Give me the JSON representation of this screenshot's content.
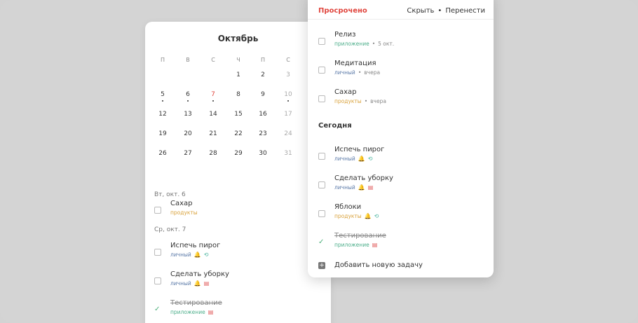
{
  "calendar": {
    "month_title": "Октябрь",
    "weekdays": [
      "П",
      "В",
      "С",
      "Ч",
      "П",
      "С"
    ],
    "weeks": [
      [
        "",
        "",
        "",
        "1",
        "2",
        "3"
      ],
      [
        "5",
        "6",
        "7",
        "8",
        "9",
        "10"
      ],
      [
        "12",
        "13",
        "14",
        "15",
        "16",
        "17"
      ],
      [
        "19",
        "20",
        "21",
        "22",
        "23",
        "24"
      ],
      [
        "26",
        "27",
        "28",
        "29",
        "30",
        "31"
      ]
    ],
    "today": "7",
    "days_with_tasks": [
      "5",
      "6",
      "7",
      "10"
    ],
    "groups": [
      {
        "date_label": "Вт, окт. 6",
        "tasks": [
          {
            "title": "Сахар",
            "tag": "продукты",
            "tag_type": "products",
            "done": false,
            "icons": []
          }
        ]
      },
      {
        "date_label": "Ср, окт. 7",
        "tasks": [
          {
            "title": "Испечь пирог",
            "tag": "личный",
            "tag_type": "personal",
            "done": false,
            "icons": [
              "bell-icon",
              "repeat-icon"
            ]
          },
          {
            "title": "Сделать уборку",
            "tag": "личный",
            "tag_type": "personal",
            "done": false,
            "icons": [
              "bell-icon",
              "document-icon"
            ]
          },
          {
            "title": "Тестирование",
            "tag": "приложение",
            "tag_type": "app",
            "done": true,
            "icons": [
              "document-icon"
            ]
          }
        ]
      }
    ]
  },
  "task_list": {
    "overdue_label": "Просрочено",
    "actions": {
      "hide": "Скрыть",
      "separator": "•",
      "reschedule": "Перенести"
    },
    "overdue": [
      {
        "title": "Релиз",
        "tag": "приложение",
        "tag_type": "app",
        "date": "5 окт."
      },
      {
        "title": "Медитация",
        "tag": "личный",
        "tag_type": "personal",
        "date": "вчера"
      },
      {
        "title": "Сахар",
        "tag": "продукты",
        "tag_type": "products",
        "date": "вчера"
      }
    ],
    "today_label": "Сегодня",
    "today": [
      {
        "title": "Испечь пирог",
        "tag": "личный",
        "tag_type": "personal",
        "done": false,
        "icons": [
          "bell-icon",
          "repeat-icon"
        ]
      },
      {
        "title": "Сделать уборку",
        "tag": "личный",
        "tag_type": "personal",
        "done": false,
        "icons": [
          "bell-icon",
          "document-icon"
        ]
      },
      {
        "title": "Яблоки",
        "tag": "продукты",
        "tag_type": "products",
        "done": false,
        "icons": [
          "bell-icon",
          "repeat-icon"
        ]
      },
      {
        "title": "Тестирование",
        "tag": "приложение",
        "tag_type": "app",
        "done": true,
        "icons": [
          "document-icon"
        ]
      }
    ],
    "add_task_label": "Добавить новую задачу",
    "meta_separator": "•"
  },
  "colors": {
    "overdue_red": "#e0453d",
    "tag_personal": "#5b7aa8",
    "tag_app": "#4cae8a",
    "tag_products": "#d9a23b",
    "check_green": "#4caf7a"
  }
}
